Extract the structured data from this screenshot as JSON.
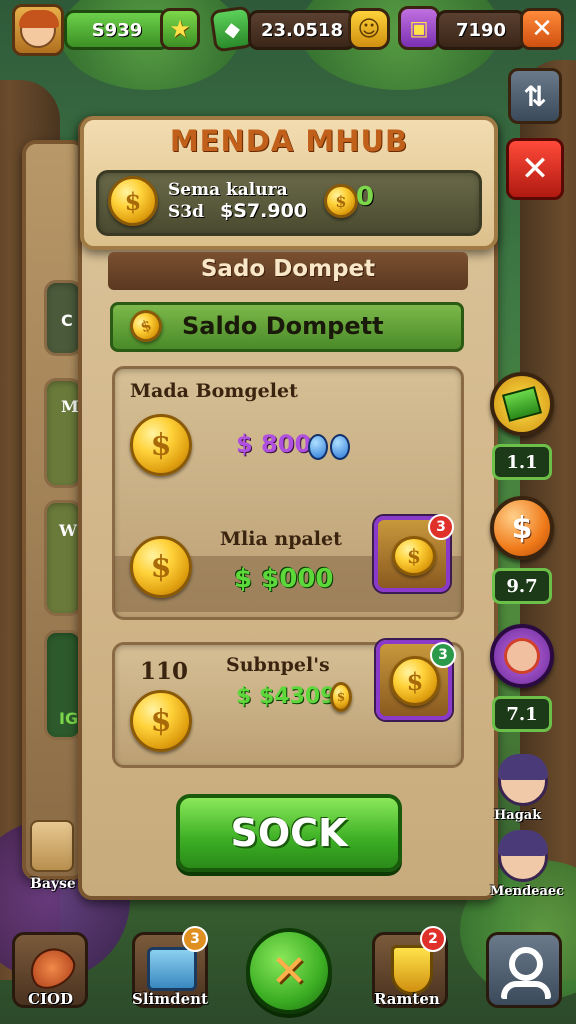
{
  "top_bar": {
    "currency_1": "S939",
    "currency_2": "23.0518",
    "currency_3": "7190",
    "star_icon": "star-icon",
    "gem_icon": "green-gem-icon",
    "smile_icon": "smiley-icon",
    "chest_icon": "purple-chest-icon"
  },
  "panel": {
    "header_title": "MENDA MHUB",
    "header_label": "Sema kalura",
    "header_amount_prefix": "S3d",
    "header_amount": "$S7.900",
    "header_coin_value": "0",
    "section_title": "Sado Dompet",
    "wallet_bar_label": "Saldo Dompett",
    "card1": {
      "title": "Mada Bomgelet",
      "amount_top": "$ 800",
      "sub_title": "Mlia npalet",
      "amount_bottom": "$ $000",
      "badge": "3"
    },
    "card2": {
      "number": "110",
      "title": "Subnpel's",
      "amount": "$ $4309",
      "badge": "3"
    },
    "action_button": "SOCK"
  },
  "side_right": {
    "chip_1": "1.1",
    "chip_2": "9.7",
    "chip_3": "7.1",
    "char_1_label": "Hagak",
    "char_2_label": "Mendeaec"
  },
  "side_left": {
    "labels": [
      "C",
      "M",
      "W",
      "IG"
    ],
    "bag_label": "Bayse"
  },
  "bottom_bar": {
    "btn_1_label": "CIOD",
    "btn_2_label": "Slimdent",
    "btn_2_badge": "3",
    "btn_4_label": "Ramten",
    "btn_4_badge": "2"
  },
  "colors": {
    "accent_green": "#5cc03a",
    "close_red": "#d83028",
    "panel_tan": "#dcc49a",
    "coin_gold": "#ffd23a"
  }
}
